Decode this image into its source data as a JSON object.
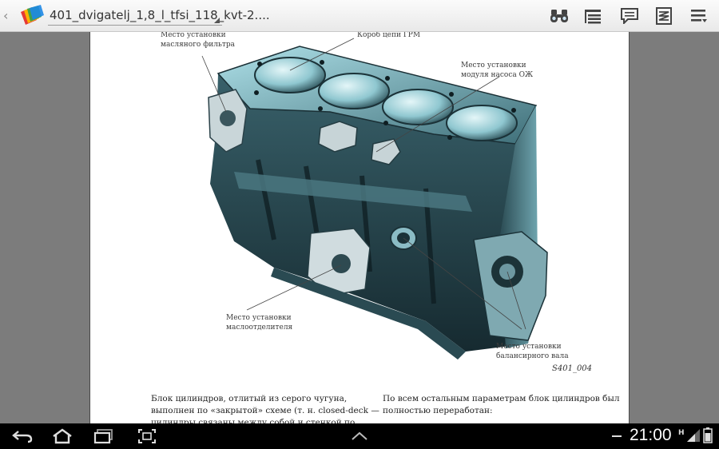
{
  "action_bar": {
    "document_title": "401_dvigatelj_1,8_l_tfsi_118_kvt-2....",
    "actions": [
      {
        "name": "binoculars-icon",
        "label": "Find"
      },
      {
        "name": "outline-icon",
        "label": "Outline"
      },
      {
        "name": "comment-icon",
        "label": "Comments"
      },
      {
        "name": "reflow-icon",
        "label": "Reflow"
      },
      {
        "name": "menu-icon",
        "label": "More"
      }
    ]
  },
  "page": {
    "callouts": {
      "oil_filter": "Место установки\nмасляного фильтра",
      "timing_case": "Короб цепи ГРМ",
      "coolant_pump": "Место установки\nмодуля насоса ОЖ",
      "oil_separator": "Место установки\nмаслоотделителя",
      "balance_shaft": "Место установки\nбалансирного вала"
    },
    "figure_id": "S401_004",
    "body_left": "Блок цилиндров, отлитый из серого чугуна,\nвыполнен по «закрытой» схеме (т. н. closed-deck —\nцилиндры связаны между собой и стенкой по",
    "body_right": "По всем остальным параметрам блок цилиндров был\nполностью переработан:"
  },
  "system_bar": {
    "clock": "21:00",
    "signal_type": "H"
  },
  "colors": {
    "actionbar": "#f2f2f2",
    "viewer_bg": "#7c7c7c",
    "page_bg": "#ffffff",
    "system_bar": "#000000",
    "engine_dark": "#1f3a42",
    "engine_light": "#8ecbd6"
  }
}
